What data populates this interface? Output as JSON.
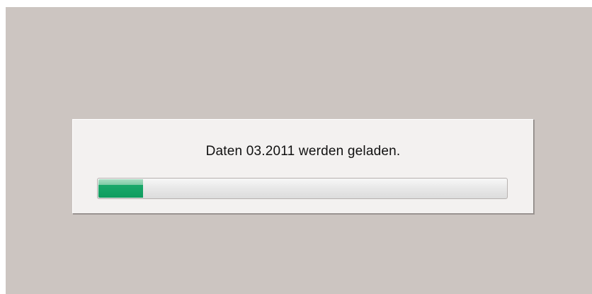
{
  "loading_dialog": {
    "message": "Daten 03.2011 werden geladen.",
    "progress_fraction": 0.11,
    "progress_color": "#13a165"
  },
  "colors": {
    "backdrop": "#ccc5c1",
    "dialog_background": "#f3f1f0"
  }
}
